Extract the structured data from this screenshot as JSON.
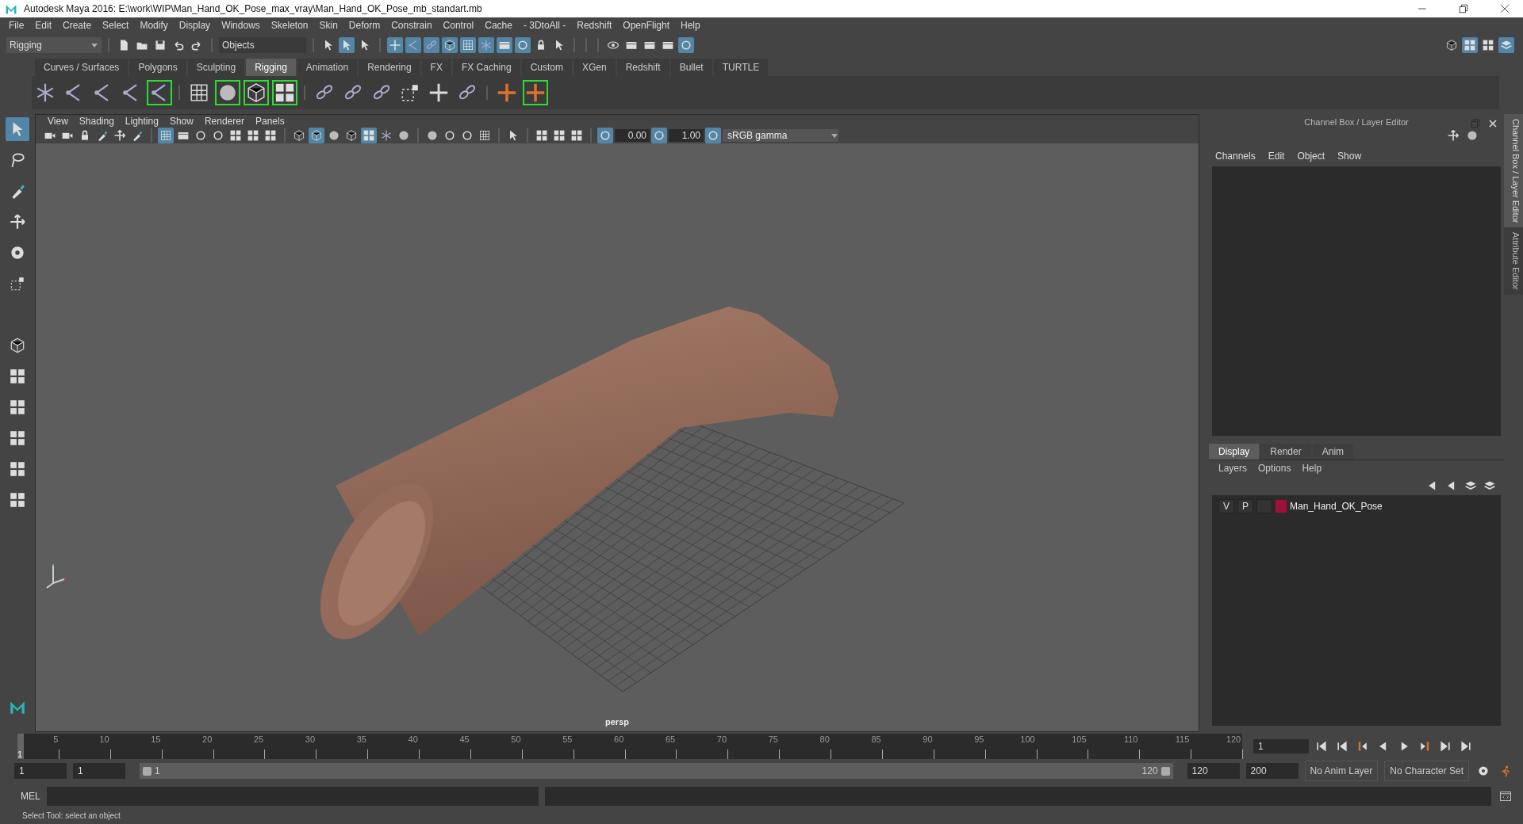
{
  "window": {
    "title": "Autodesk Maya 2016: E:\\work\\WIP\\Man_Hand_OK_Pose_max_vray\\Man_Hand_OK_Pose_mb_standart.mb"
  },
  "menu_bar": [
    "File",
    "Edit",
    "Create",
    "Select",
    "Modify",
    "Display",
    "Windows",
    "Skeleton",
    "Skin",
    "Deform",
    "Constrain",
    "Control",
    "Cache",
    "- 3DtoAll -",
    "Redshift",
    "OpenFlight",
    "Help"
  ],
  "status_line": {
    "menu_set": "Rigging",
    "selection_mode": "Objects"
  },
  "shelf": {
    "tabs": [
      {
        "label": "Curves / Surfaces",
        "selected": false
      },
      {
        "label": "Polygons",
        "selected": false
      },
      {
        "label": "Sculpting",
        "selected": false
      },
      {
        "label": "Rigging",
        "selected": true
      },
      {
        "label": "Animation",
        "selected": false
      },
      {
        "label": "Rendering",
        "selected": false
      },
      {
        "label": "FX",
        "selected": false
      },
      {
        "label": "FX Caching",
        "selected": false
      },
      {
        "label": "Custom",
        "selected": false
      },
      {
        "label": "XGen",
        "selected": false
      },
      {
        "label": "Redshift",
        "selected": false
      },
      {
        "label": "Bullet",
        "selected": false
      },
      {
        "label": "TURTLE",
        "selected": false
      }
    ]
  },
  "viewport": {
    "menu": [
      "View",
      "Shading",
      "Lighting",
      "Show",
      "Renderer",
      "Panels"
    ],
    "exposure": "0.00",
    "gamma": "1.00",
    "color_space": "sRGB gamma",
    "camera": "persp"
  },
  "channel_box": {
    "title": "Channel Box / Layer Editor",
    "menu": [
      "Channels",
      "Edit",
      "Object",
      "Show"
    ]
  },
  "layer_editor": {
    "tabs": [
      {
        "label": "Display",
        "selected": true
      },
      {
        "label": "Render",
        "selected": false
      },
      {
        "label": "Anim",
        "selected": false
      }
    ],
    "menu": [
      "Layers",
      "Options",
      "Help"
    ],
    "layers": [
      {
        "visibility": "V",
        "playback": "P",
        "color": "#a0103a",
        "name": "Man_Hand_OK_Pose"
      }
    ]
  },
  "side_tabs": [
    {
      "label": "Channel Box / Layer Editor",
      "selected": true
    },
    {
      "label": "Attribute Editor",
      "selected": false
    }
  ],
  "time_slider": {
    "ticks": [
      "5",
      "10",
      "15",
      "20",
      "25",
      "30",
      "35",
      "40",
      "45",
      "50",
      "55",
      "60",
      "65",
      "70",
      "75",
      "80",
      "85",
      "90",
      "95",
      "100",
      "105",
      "110",
      "115",
      "120"
    ],
    "current_frame_marker": "1",
    "current_frame": "1",
    "level": 0
  },
  "range_slider": {
    "level": 1,
    "start": "1",
    "playback_start": "1",
    "range_start": "1",
    "range_end": "120",
    "playback_end": "120",
    "end": "200",
    "anim_layer": "No Anim Layer",
    "character_set": "No Character Set"
  },
  "command_line": {
    "label": "MEL"
  },
  "help_line": "Select Tool: select an object"
}
